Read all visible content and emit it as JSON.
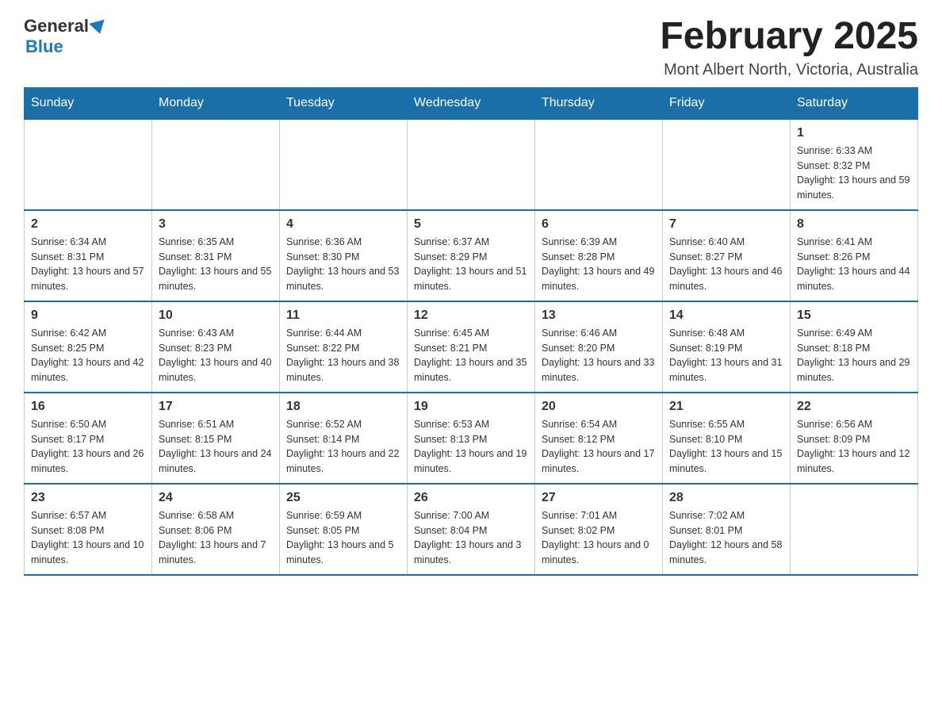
{
  "header": {
    "logo_general": "General",
    "logo_blue": "Blue",
    "month_title": "February 2025",
    "location": "Mont Albert North, Victoria, Australia"
  },
  "days_of_week": [
    "Sunday",
    "Monday",
    "Tuesday",
    "Wednesday",
    "Thursday",
    "Friday",
    "Saturday"
  ],
  "weeks": [
    [
      {
        "day": "",
        "info": ""
      },
      {
        "day": "",
        "info": ""
      },
      {
        "day": "",
        "info": ""
      },
      {
        "day": "",
        "info": ""
      },
      {
        "day": "",
        "info": ""
      },
      {
        "day": "",
        "info": ""
      },
      {
        "day": "1",
        "info": "Sunrise: 6:33 AM\nSunset: 8:32 PM\nDaylight: 13 hours and 59 minutes."
      }
    ],
    [
      {
        "day": "2",
        "info": "Sunrise: 6:34 AM\nSunset: 8:31 PM\nDaylight: 13 hours and 57 minutes."
      },
      {
        "day": "3",
        "info": "Sunrise: 6:35 AM\nSunset: 8:31 PM\nDaylight: 13 hours and 55 minutes."
      },
      {
        "day": "4",
        "info": "Sunrise: 6:36 AM\nSunset: 8:30 PM\nDaylight: 13 hours and 53 minutes."
      },
      {
        "day": "5",
        "info": "Sunrise: 6:37 AM\nSunset: 8:29 PM\nDaylight: 13 hours and 51 minutes."
      },
      {
        "day": "6",
        "info": "Sunrise: 6:39 AM\nSunset: 8:28 PM\nDaylight: 13 hours and 49 minutes."
      },
      {
        "day": "7",
        "info": "Sunrise: 6:40 AM\nSunset: 8:27 PM\nDaylight: 13 hours and 46 minutes."
      },
      {
        "day": "8",
        "info": "Sunrise: 6:41 AM\nSunset: 8:26 PM\nDaylight: 13 hours and 44 minutes."
      }
    ],
    [
      {
        "day": "9",
        "info": "Sunrise: 6:42 AM\nSunset: 8:25 PM\nDaylight: 13 hours and 42 minutes."
      },
      {
        "day": "10",
        "info": "Sunrise: 6:43 AM\nSunset: 8:23 PM\nDaylight: 13 hours and 40 minutes."
      },
      {
        "day": "11",
        "info": "Sunrise: 6:44 AM\nSunset: 8:22 PM\nDaylight: 13 hours and 38 minutes."
      },
      {
        "day": "12",
        "info": "Sunrise: 6:45 AM\nSunset: 8:21 PM\nDaylight: 13 hours and 35 minutes."
      },
      {
        "day": "13",
        "info": "Sunrise: 6:46 AM\nSunset: 8:20 PM\nDaylight: 13 hours and 33 minutes."
      },
      {
        "day": "14",
        "info": "Sunrise: 6:48 AM\nSunset: 8:19 PM\nDaylight: 13 hours and 31 minutes."
      },
      {
        "day": "15",
        "info": "Sunrise: 6:49 AM\nSunset: 8:18 PM\nDaylight: 13 hours and 29 minutes."
      }
    ],
    [
      {
        "day": "16",
        "info": "Sunrise: 6:50 AM\nSunset: 8:17 PM\nDaylight: 13 hours and 26 minutes."
      },
      {
        "day": "17",
        "info": "Sunrise: 6:51 AM\nSunset: 8:15 PM\nDaylight: 13 hours and 24 minutes."
      },
      {
        "day": "18",
        "info": "Sunrise: 6:52 AM\nSunset: 8:14 PM\nDaylight: 13 hours and 22 minutes."
      },
      {
        "day": "19",
        "info": "Sunrise: 6:53 AM\nSunset: 8:13 PM\nDaylight: 13 hours and 19 minutes."
      },
      {
        "day": "20",
        "info": "Sunrise: 6:54 AM\nSunset: 8:12 PM\nDaylight: 13 hours and 17 minutes."
      },
      {
        "day": "21",
        "info": "Sunrise: 6:55 AM\nSunset: 8:10 PM\nDaylight: 13 hours and 15 minutes."
      },
      {
        "day": "22",
        "info": "Sunrise: 6:56 AM\nSunset: 8:09 PM\nDaylight: 13 hours and 12 minutes."
      }
    ],
    [
      {
        "day": "23",
        "info": "Sunrise: 6:57 AM\nSunset: 8:08 PM\nDaylight: 13 hours and 10 minutes."
      },
      {
        "day": "24",
        "info": "Sunrise: 6:58 AM\nSunset: 8:06 PM\nDaylight: 13 hours and 7 minutes."
      },
      {
        "day": "25",
        "info": "Sunrise: 6:59 AM\nSunset: 8:05 PM\nDaylight: 13 hours and 5 minutes."
      },
      {
        "day": "26",
        "info": "Sunrise: 7:00 AM\nSunset: 8:04 PM\nDaylight: 13 hours and 3 minutes."
      },
      {
        "day": "27",
        "info": "Sunrise: 7:01 AM\nSunset: 8:02 PM\nDaylight: 13 hours and 0 minutes."
      },
      {
        "day": "28",
        "info": "Sunrise: 7:02 AM\nSunset: 8:01 PM\nDaylight: 12 hours and 58 minutes."
      },
      {
        "day": "",
        "info": ""
      }
    ]
  ]
}
